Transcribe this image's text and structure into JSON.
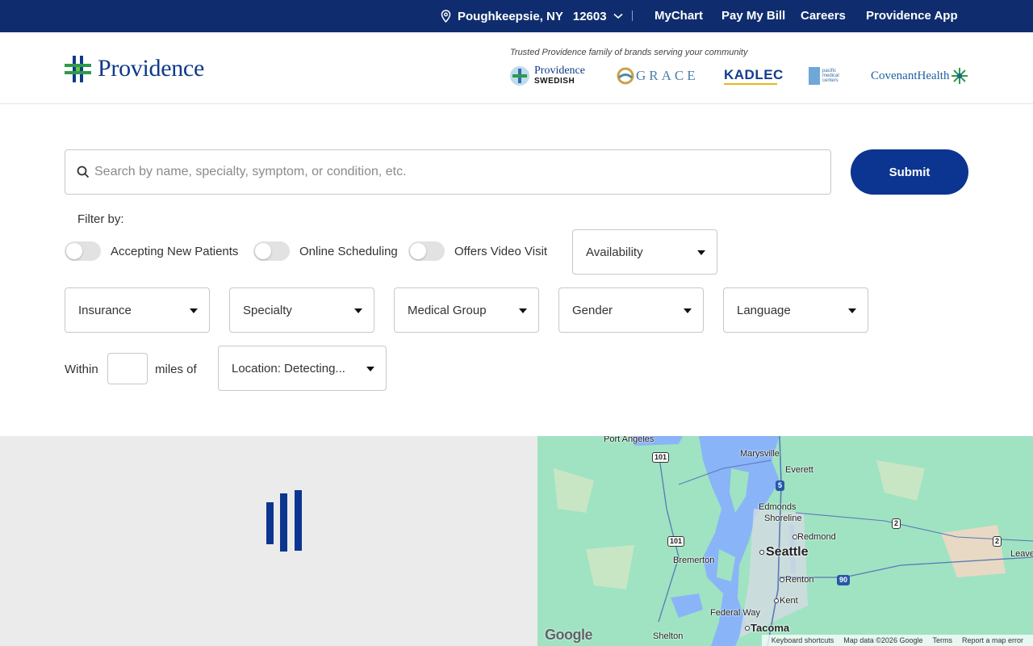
{
  "topbar": {
    "location": "Poughkeepsie, NY",
    "zip": "12603",
    "links": [
      "MyChart",
      "Pay My Bill",
      "Careers",
      "Providence App"
    ]
  },
  "header": {
    "logo": "Providence",
    "trusted": "Trusted Providence family of brands serving your community",
    "brands": {
      "swedish_1": "Providence",
      "swedish_2": "SWEDISH",
      "grace": "GRACE",
      "kadlec": "KADLEC",
      "pacific": "pacific medical centers",
      "covenant": "CovenantHealth"
    }
  },
  "search": {
    "placeholder": "Search by name, specialty, symptom, or condition, etc.",
    "submit": "Submit"
  },
  "filters": {
    "label": "Filter by:",
    "toggles": [
      "Accepting New Patients",
      "Online Scheduling",
      "Offers Video Visit"
    ],
    "availability": "Availability",
    "dropdowns": [
      "Insurance",
      "Specialty",
      "Medical Group",
      "Gender",
      "Language"
    ],
    "within": "Within",
    "miles_of": "miles of",
    "location": "Location: Detecting..."
  },
  "map": {
    "cities": {
      "port_angeles": "Port Angeles",
      "marysville": "Marysville",
      "everett": "Everett",
      "edmonds": "Edmonds",
      "shoreline": "Shoreline",
      "redmond": "Redmond",
      "seattle": "Seattle",
      "bremerton": "Bremerton",
      "renton": "Renton",
      "kent": "Kent",
      "federal_way": "Federal Way",
      "tacoma": "Tacoma",
      "shelton": "Shelton",
      "leave": "Leave"
    },
    "shields": {
      "us101a": "101",
      "us101b": "101",
      "i5": "5",
      "i90": "90",
      "wa2a": "2",
      "wa2b": "2"
    },
    "google": "Google",
    "attribution": [
      "Keyboard shortcuts",
      "Map data ©2026 Google",
      "Terms",
      "Report a map error"
    ]
  }
}
